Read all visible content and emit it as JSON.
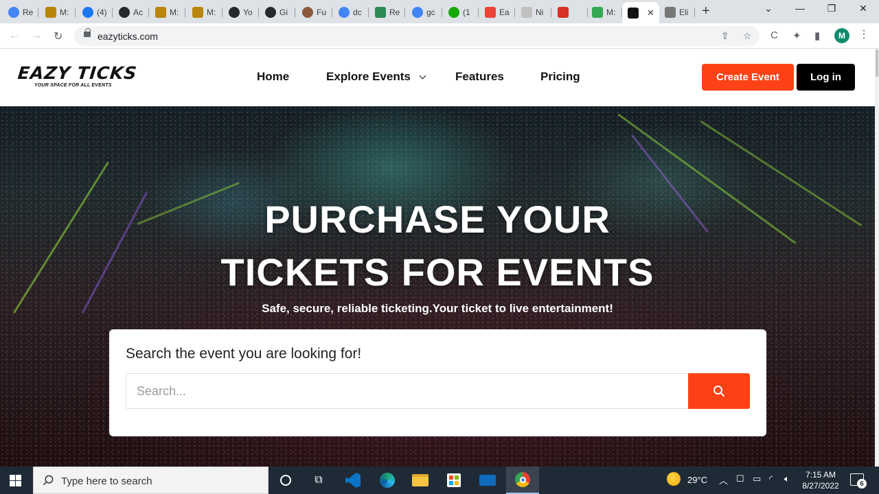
{
  "browser": {
    "tabs": [
      {
        "label": "Re",
        "icon": "google-icon",
        "color": "#4285f4"
      },
      {
        "label": "M:",
        "icon": "profile-photo-icon",
        "color": "#b8860b"
      },
      {
        "label": "(4)",
        "icon": "facebook-icon",
        "color": "#1877f2"
      },
      {
        "label": "Ac",
        "icon": "github-icon",
        "color": "#24292e"
      },
      {
        "label": "M:",
        "icon": "profile-photo-icon",
        "color": "#b8860b"
      },
      {
        "label": "M:",
        "icon": "profile-photo-icon",
        "color": "#b8860b"
      },
      {
        "label": "Yo",
        "icon": "github-icon",
        "color": "#24292e"
      },
      {
        "label": "Gi",
        "icon": "github-icon",
        "color": "#24292e"
      },
      {
        "label": "Fu",
        "icon": "avatar-icon",
        "color": "#8b5a3c"
      },
      {
        "label": "dc",
        "icon": "google-icon",
        "color": "#4285f4"
      },
      {
        "label": "Re",
        "icon": "vue-icon",
        "color": "#2e8b57"
      },
      {
        "label": "gc",
        "icon": "google-icon",
        "color": "#4285f4"
      },
      {
        "label": "(1",
        "icon": "upwork-icon",
        "color": "#14a800"
      },
      {
        "label": "Ea",
        "icon": "play-icon",
        "color": "#ea4335"
      },
      {
        "label": "Ni",
        "icon": "feather-icon",
        "color": "#c0c0c0"
      },
      {
        "label": "",
        "icon": "tbc-icon",
        "color": "#d93025"
      },
      {
        "label": "M:",
        "icon": "leaf-icon",
        "color": "#34a853"
      },
      {
        "label": "",
        "icon": "eazyticks-icon",
        "color": "#111111",
        "active": true
      },
      {
        "label": "Eli",
        "icon": "document-icon",
        "color": "#777777"
      }
    ],
    "url": "eazyticks.com",
    "profile_initial": "M"
  },
  "site": {
    "logo_text": "EAZY TICKS",
    "logo_tagline": "YOUR SPACE FOR ALL EVENTS",
    "nav": [
      "Home",
      "Explore Events",
      "Features",
      "Pricing"
    ],
    "create_event": "Create Event",
    "login": "Log in",
    "accent_color": "#ff4215"
  },
  "hero": {
    "title_line1": "PURCHASE YOUR",
    "title_line2": "TICKETS FOR EVENTS",
    "subtitle": "Safe, secure, reliable ticketing.Your ticket to live entertainment!",
    "search_heading": "Search the event you are looking for!",
    "search_placeholder": "Search..."
  },
  "taskbar": {
    "search_placeholder": "Type here to search",
    "weather": "29°C",
    "time": "7:15 AM",
    "date": "8/27/2022",
    "notifications": "6"
  }
}
